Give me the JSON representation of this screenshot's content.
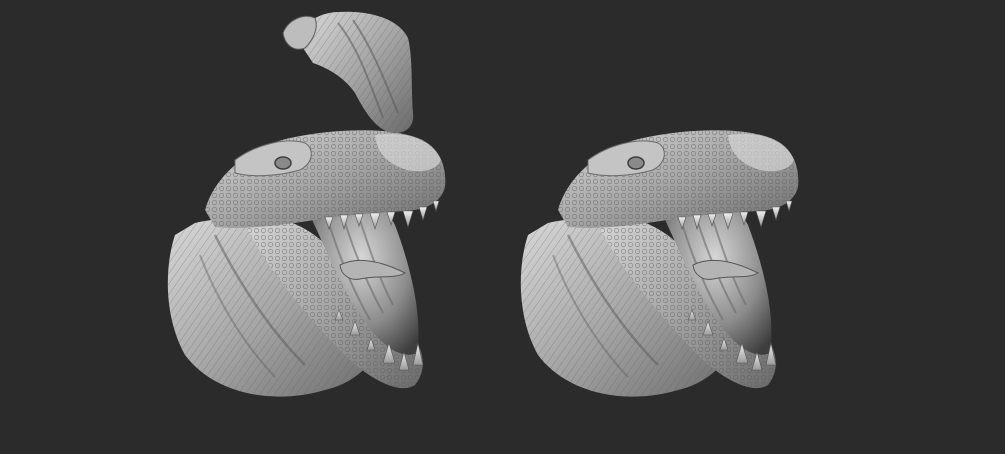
{
  "viewport": {
    "background_color": "#2b2b2b"
  },
  "models": [
    {
      "id": "left",
      "subject": "dinosaur-head-sculpt",
      "state": "with-extra-mesh-on-top",
      "base_color": "#a8a8a8",
      "shadow_color": "#4a4a4a",
      "highlight_color": "#e4e4e4"
    },
    {
      "id": "right",
      "subject": "dinosaur-head-sculpt",
      "state": "clean",
      "base_color": "#a8a8a8",
      "shadow_color": "#4a4a4a",
      "highlight_color": "#e4e4e4"
    }
  ]
}
